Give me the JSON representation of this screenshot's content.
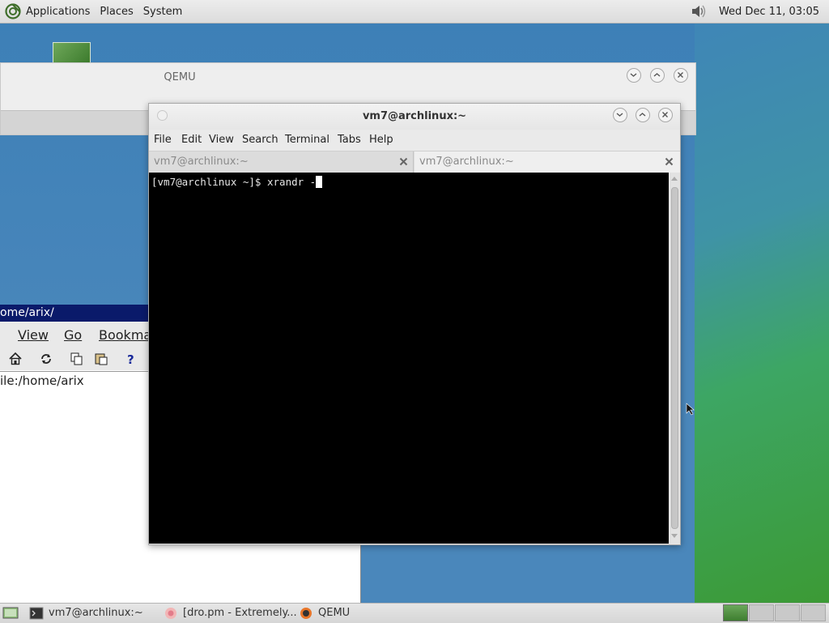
{
  "top_panel": {
    "menus": [
      "Applications",
      "Places",
      "System"
    ],
    "clock": "Wed Dec 11, 03:05",
    "icons": {
      "distro": "distro-logo-icon",
      "volume": "volume-icon"
    }
  },
  "qemu_window": {
    "title": "QEMU"
  },
  "file_manager": {
    "title": "ome/arix/",
    "menu": [
      "View",
      "Go",
      "Bookma"
    ],
    "location": "ile:/home/arix",
    "tools": [
      "home-icon",
      "reload-icon",
      "copy-icon",
      "paste-icon",
      "help-icon"
    ]
  },
  "terminal": {
    "title": "vm7@archlinux:~",
    "menu": [
      "File",
      "Edit",
      "View",
      "Search",
      "Terminal",
      "Tabs",
      "Help"
    ],
    "tabs": [
      {
        "label": "vm7@archlinux:~"
      },
      {
        "label": "vm7@archlinux:~"
      }
    ],
    "prompt": "[vm7@archlinux ~]$ xrandr -"
  },
  "taskbar": {
    "items": [
      {
        "label": "vm7@archlinux:~",
        "icon": "terminal-icon"
      },
      {
        "label": "[dro.pm - Extremely...",
        "icon": "browser-icon"
      },
      {
        "label": "QEMU",
        "icon": "qemu-icon"
      }
    ],
    "workspaces": 4,
    "active_workspace": 1
  },
  "colors": {
    "desktop": "#3d7fb5",
    "panel": "#e0e0e0",
    "terminal_bg": "#000000",
    "fm_title_bg": "#0a1a6a"
  }
}
